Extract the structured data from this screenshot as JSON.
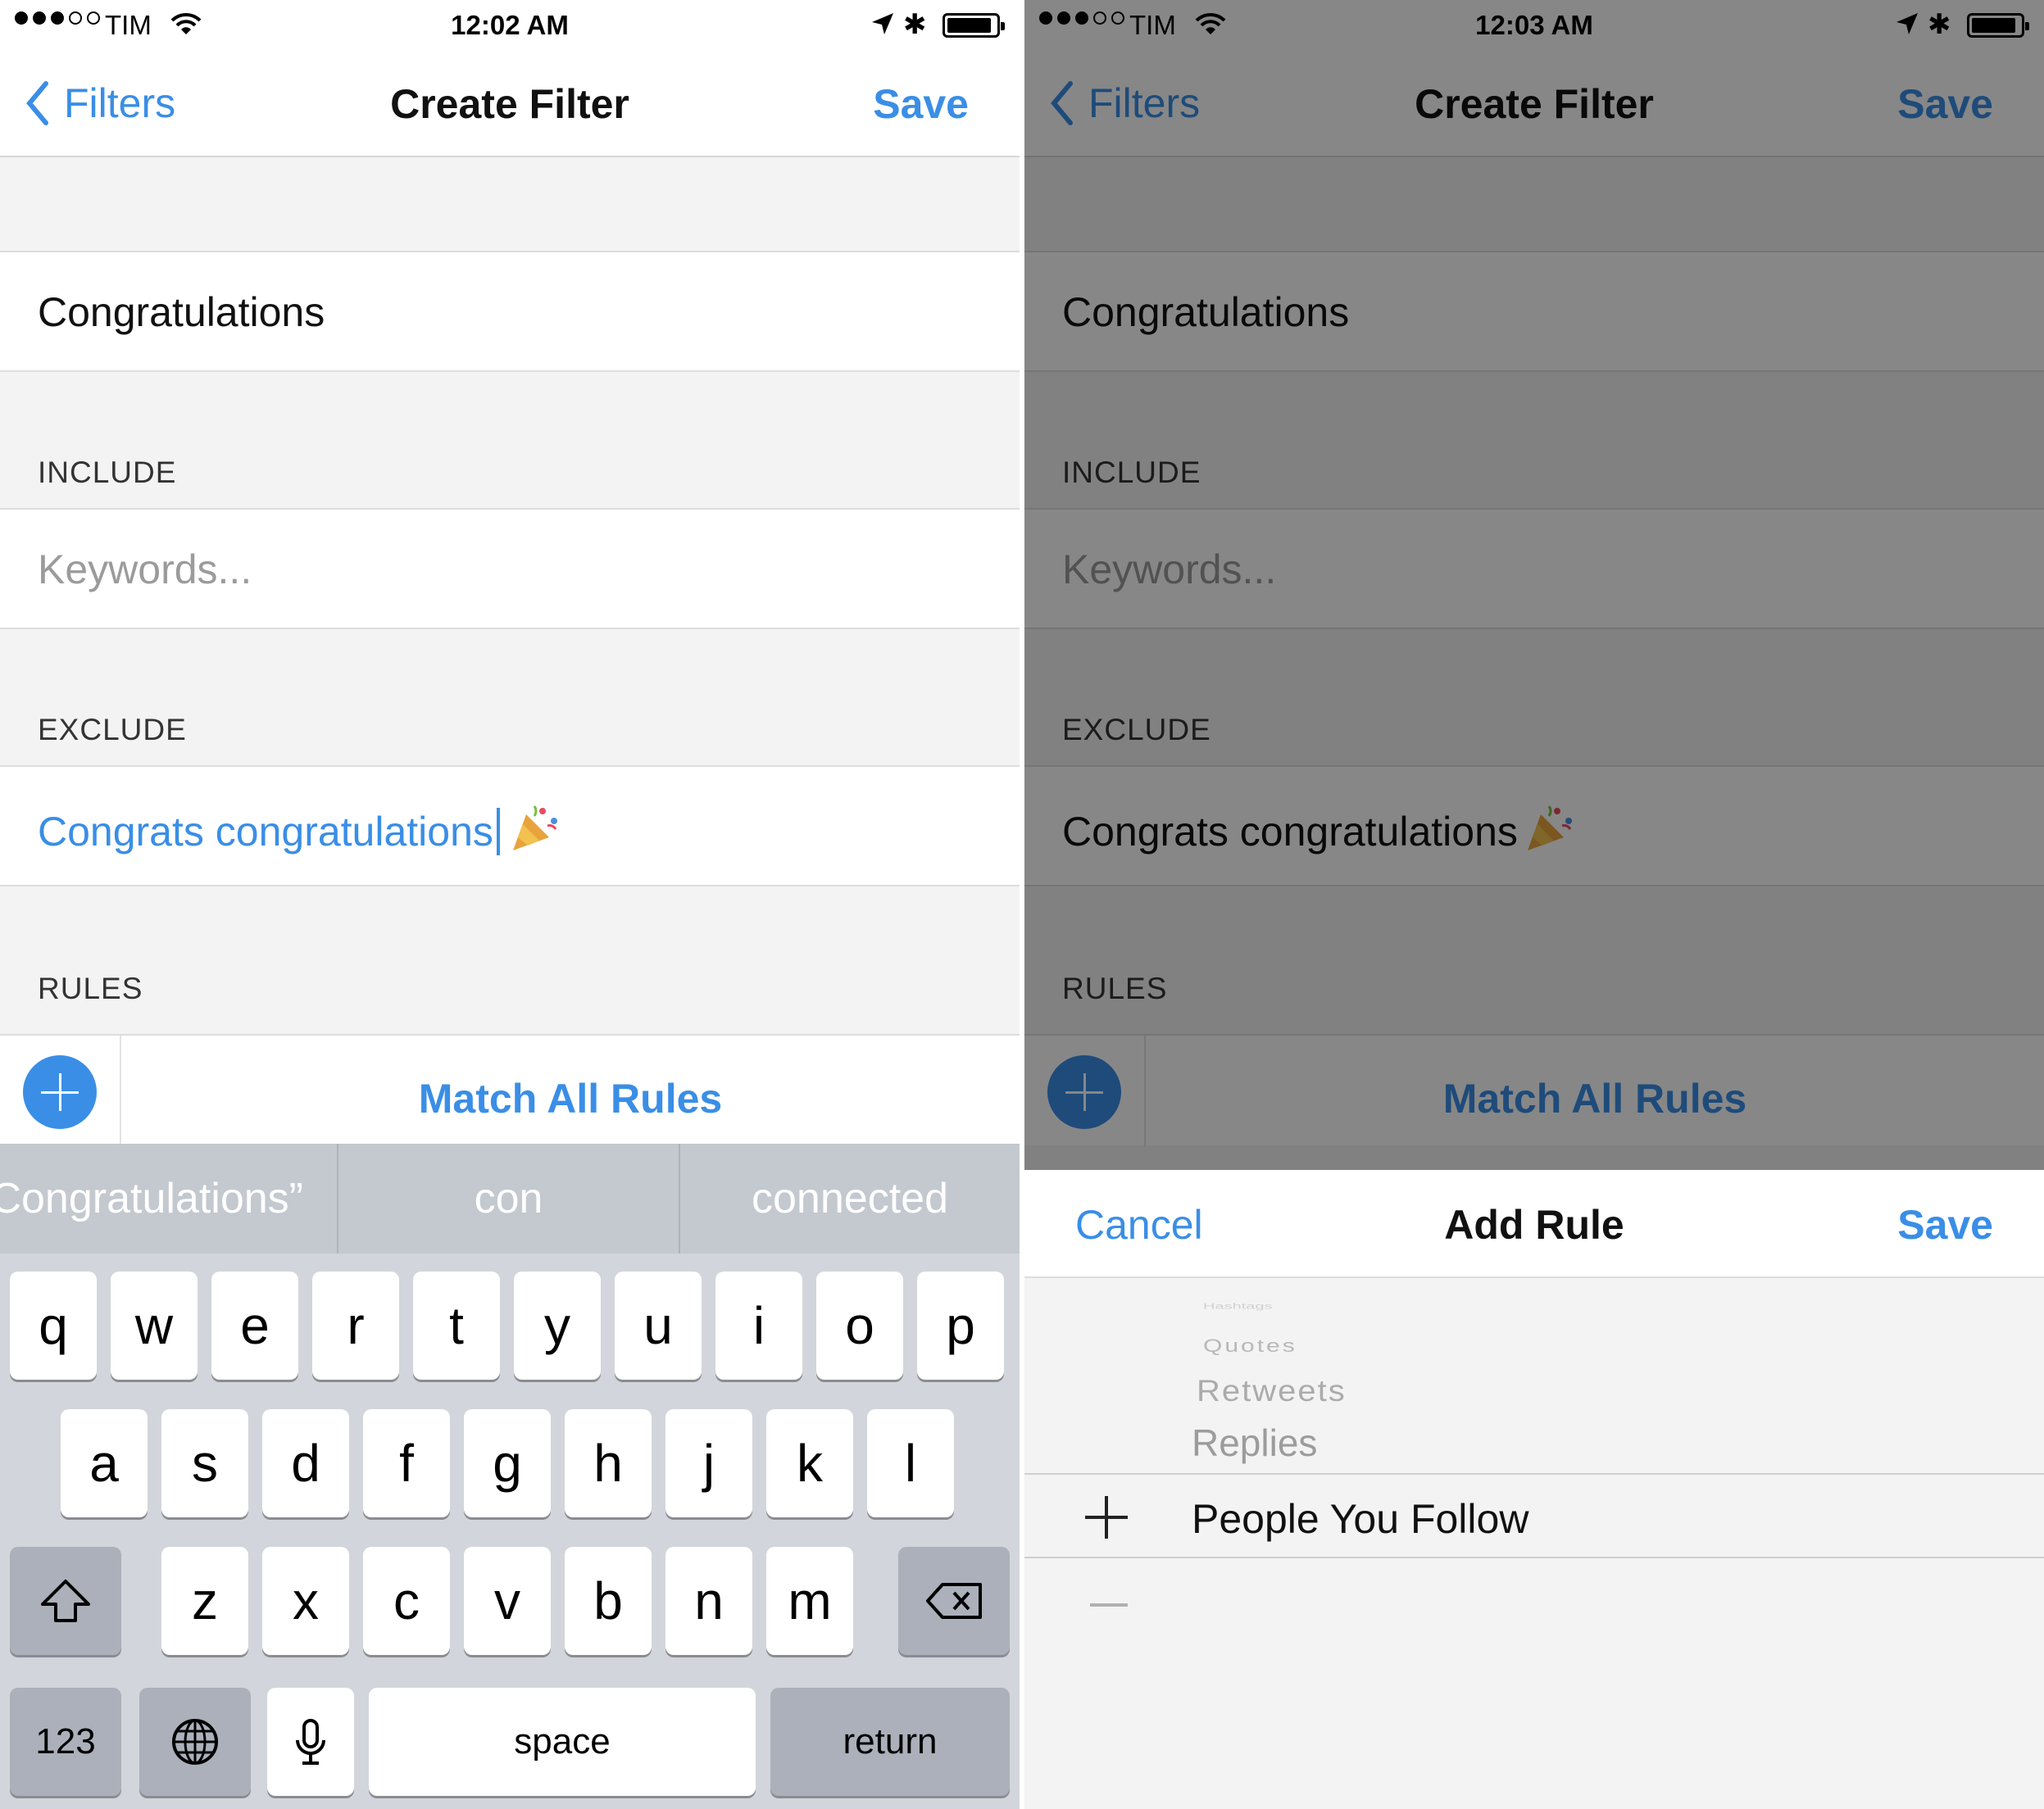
{
  "left": {
    "status": {
      "carrier": "TIM",
      "time": "12:02 AM"
    },
    "nav": {
      "back": "Filters",
      "title": "Create Filter",
      "save": "Save"
    },
    "name_value": "Congratulations",
    "include": {
      "header": "INCLUDE",
      "placeholder": "Keywords..."
    },
    "exclude": {
      "header": "EXCLUDE",
      "value": "Congrats congratulations"
    },
    "rules": {
      "header": "RULES",
      "match": "Match All Rules"
    },
    "keyboard": {
      "predictions": [
        "“Congratulations”",
        "con",
        "connected"
      ],
      "row1": [
        "q",
        "w",
        "e",
        "r",
        "t",
        "y",
        "u",
        "i",
        "o",
        "p"
      ],
      "row2": [
        "a",
        "s",
        "d",
        "f",
        "g",
        "h",
        "j",
        "k",
        "l"
      ],
      "row3": [
        "z",
        "x",
        "c",
        "v",
        "b",
        "n",
        "m"
      ],
      "numbers_key": "123",
      "space_key": "space",
      "return_key": "return"
    }
  },
  "right": {
    "status": {
      "carrier": "TIM",
      "time": "12:03 AM"
    },
    "nav": {
      "back": "Filters",
      "title": "Create Filter",
      "save": "Save"
    },
    "name_value": "Congratulations",
    "include": {
      "header": "INCLUDE",
      "placeholder": "Keywords..."
    },
    "exclude": {
      "header": "EXCLUDE",
      "value": "Congrats congratulations"
    },
    "rules": {
      "header": "RULES",
      "match": "Match All Rules"
    },
    "sheet": {
      "cancel": "Cancel",
      "title": "Add Rule",
      "save": "Save",
      "picker_items": [
        "Hashtags",
        "Quotes",
        "Retweets",
        "Replies"
      ],
      "picker_selected": "People You Follow"
    }
  },
  "colors": {
    "accent": "#3a8ee6",
    "background": "#f3f3f3",
    "keyboard": "#d2d5db"
  }
}
